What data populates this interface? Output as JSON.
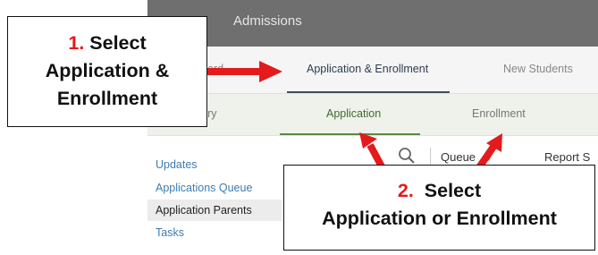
{
  "window": {
    "title": "Admissions"
  },
  "tabs": [
    {
      "label": "Dashboard",
      "active": false
    },
    {
      "label": "Application & Enrollment",
      "active": true
    },
    {
      "label": "New Students",
      "active": false
    }
  ],
  "subtabs": [
    {
      "label": "Summary",
      "active": false
    },
    {
      "label": "Application",
      "active": true
    },
    {
      "label": "Enrollment",
      "active": false
    }
  ],
  "sidebar": {
    "items": [
      {
        "label": "Updates",
        "active": false
      },
      {
        "label": "Applications Queue",
        "active": false
      },
      {
        "label": "Application Parents",
        "active": true
      },
      {
        "label": "Tasks",
        "active": false
      }
    ]
  },
  "toolbar": {
    "search_icon": "search-icon",
    "queue_label": "Queue",
    "queue_caret": "▾",
    "report_label": "Report S"
  },
  "callouts": {
    "step1": {
      "number": "1.",
      "line1": "Select",
      "line2": "Application &",
      "line3": "Enrollment"
    },
    "step2": {
      "number": "2.",
      "line1": "Select",
      "line2": "Application or Enrollment"
    }
  },
  "colors": {
    "annotation_red": "#e41a1c",
    "titlebar": "#6f6f6f",
    "active_tab_underline": "#3d4e63",
    "active_subtab": "#5b8a44",
    "link_blue": "#3e7cb1"
  }
}
